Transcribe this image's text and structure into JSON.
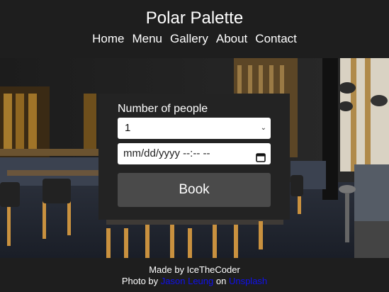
{
  "header": {
    "title": "Polar Palette",
    "nav": [
      "Home",
      "Menu",
      "Gallery",
      "About",
      "Contact"
    ]
  },
  "form": {
    "people_label": "Number of people",
    "people_value": "1",
    "datetime_placeholder": "mm/dd/yyyy --:-- --",
    "book_label": "Book"
  },
  "footer": {
    "made_by": "Made by IceTheCoder",
    "photo_prefix": "Photo by",
    "photographer": "Jason Leung",
    "on_text": "on",
    "site": "Unsplash"
  },
  "colors": {
    "background": "#1e1e1e",
    "form_panel": "#232323",
    "button": "#4a4a4a",
    "link": "#1010ee"
  },
  "icons": {
    "select_chevron": "chevron-down-icon",
    "calendar": "calendar-icon"
  }
}
